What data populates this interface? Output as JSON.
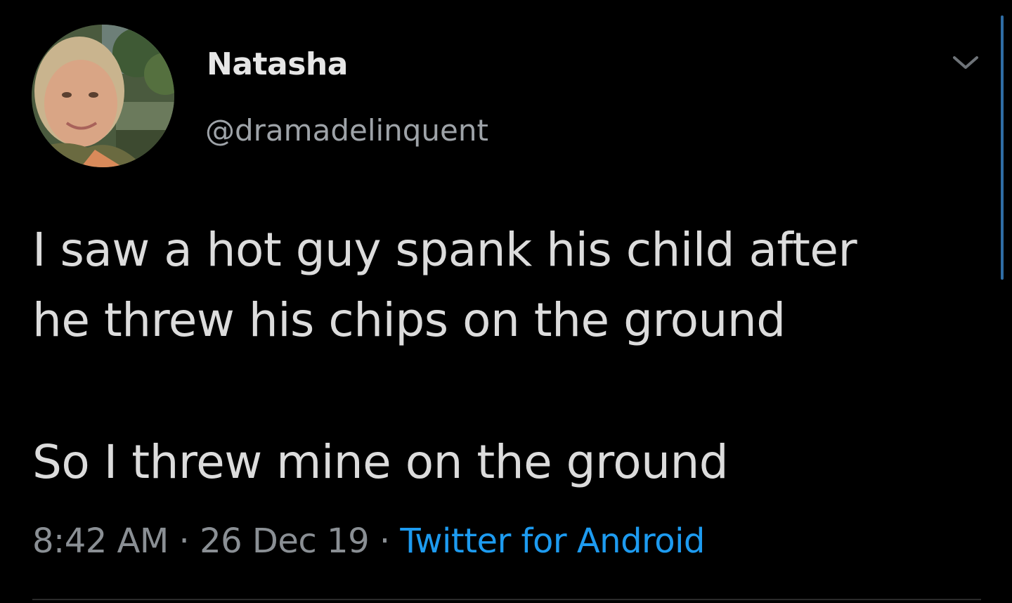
{
  "user": {
    "display_name": "Natasha",
    "handle": "@dramadelinquent",
    "avatar_icon": "profile-photo"
  },
  "tweet": {
    "lines": [
      "I saw a hot guy spank his child after",
      "he threw his chips on the ground",
      "So I threw mine on the ground"
    ]
  },
  "meta": {
    "time": "8:42 AM",
    "separator": " · ",
    "date": "26 Dec 19",
    "source": "Twitter for Android"
  },
  "icons": {
    "menu": "chevron-down-icon"
  },
  "colors": {
    "background": "#000000",
    "text": "#dcdcdc",
    "secondary_text": "#8a8f94",
    "link": "#1d9bf0",
    "scrollbar": "#2f6da5"
  }
}
